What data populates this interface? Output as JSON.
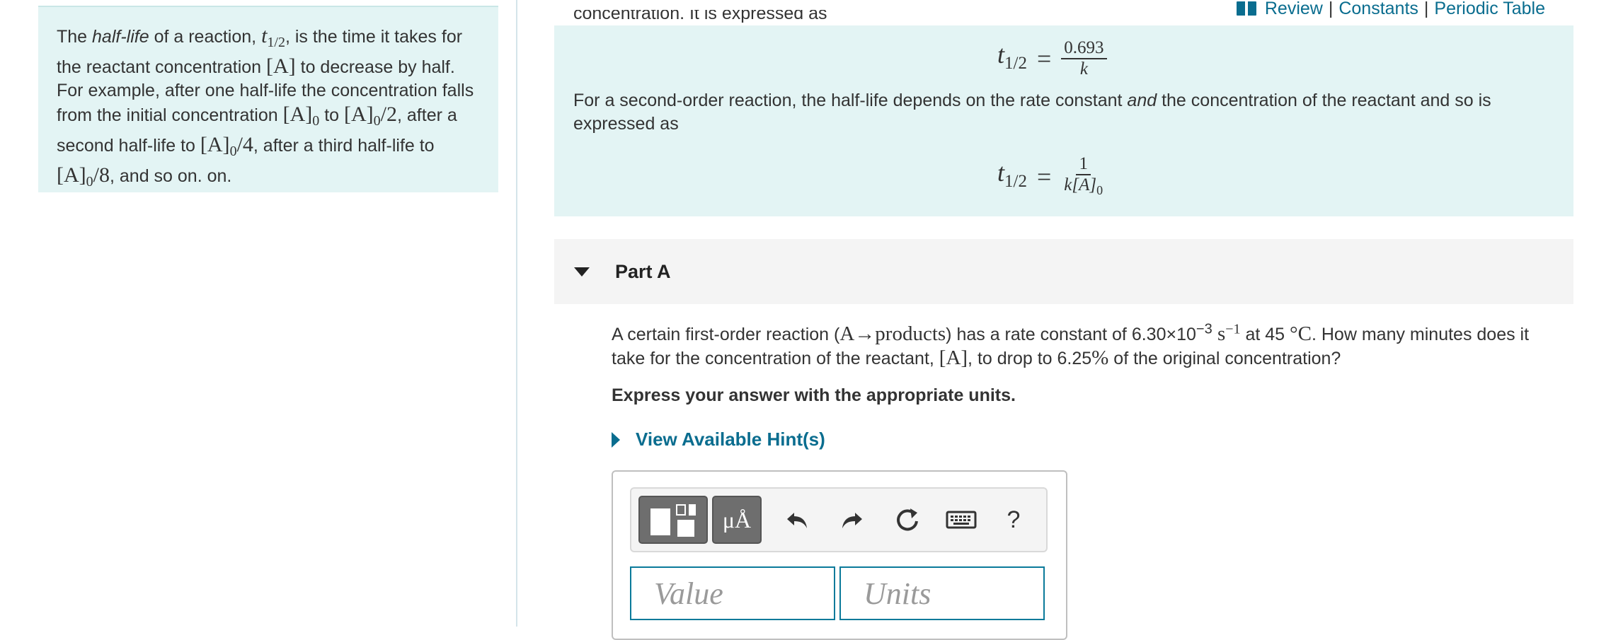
{
  "intro": {
    "t1": "The ",
    "t2": "half-life",
    "t3": " of a reaction, ",
    "t4": ", is the time it takes for the reactant concentration ",
    "t5": " to decrease by half. For example, after one half-life the concentration falls from the initial concentration ",
    "t6": " to ",
    "t7": ", after a second half-life to ",
    "t8": ", after a third half-life to ",
    "t9": ", and so on. on.",
    "m_t": "t",
    "m_sub": "1/2",
    "m_A": "[A]",
    "m_A0": "[A]",
    "m_0": "0",
    "m_div2": "/2",
    "m_div4": "/4",
    "m_div8": "/8"
  },
  "top_links": {
    "review": "Review",
    "constants": "Constants",
    "periodic": "Periodic Table",
    "sep": "|"
  },
  "info": {
    "cut_text": "concentration. It is expressed as",
    "eq1": {
      "lhs": "t",
      "sub": "1/2",
      "eq": "=",
      "num": "0.693",
      "den": "k"
    },
    "para_a": "For a second-order reaction, the half-life depends on the rate constant ",
    "para_and": "and",
    "para_b": " the concentration of the reactant  and so is expressed as",
    "eq2": {
      "lhs": "t",
      "sub": "1/2",
      "eq": "=",
      "num": "1",
      "den": "k[A]",
      "den_sub": "0"
    }
  },
  "part_a": {
    "title": "Part A",
    "q1": "A certain first-order reaction (",
    "q_math": "A→products",
    "q2": ") has a rate constant of 6.30×10",
    "q_exp": "−3",
    "q_units": " s",
    "q_uexp": "−1",
    "q3": " at 45 ",
    "q_deg": "°C",
    "q4": ". How many minutes does it take for the concentration of the reactant, ",
    "q_A": "[A]",
    "q5": ", to drop to 6.25",
    "q_pct": "%",
    "q6": " of the original concentration?",
    "instruction": "Express your answer with the appropriate units.",
    "hint": "View Available Hint(s)"
  },
  "answer": {
    "greek_label": "μÅ",
    "help_label": "?",
    "value_placeholder": "Value",
    "units_placeholder": "Units"
  },
  "colors": {
    "panel_bg": "#e3f4f4",
    "link": "#0a6d8f",
    "field_border": "#0a7a9a"
  }
}
